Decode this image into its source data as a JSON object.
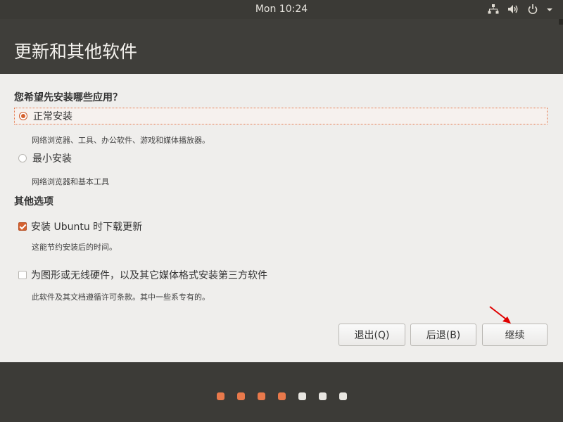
{
  "topbar": {
    "clock": "Mon 10:24"
  },
  "header": {
    "title": "更新和其他软件"
  },
  "main": {
    "question": "您希望先安装哪些应用？",
    "normal_install": {
      "label": "正常安装",
      "desc": "网络浏览器、工具、办公软件、游戏和媒体播放器。",
      "selected": true
    },
    "minimal_install": {
      "label": "最小安装",
      "desc": "网络浏览器和基本工具",
      "selected": false
    },
    "other_options": "其他选项",
    "download_updates": {
      "label": "安装 Ubuntu 时下载更新",
      "desc": "这能节约安装后的时间。",
      "checked": true
    },
    "third_party": {
      "label": "为图形或无线硬件，以及其它媒体格式安装第三方软件",
      "desc": "此软件及其文档遵循许可条款。其中一些系专有的。",
      "checked": false
    }
  },
  "buttons": {
    "quit": "退出(Q)",
    "back": "后退(B)",
    "continue": "继续"
  },
  "progress": {
    "total": 7,
    "completed": 4
  },
  "colors": {
    "accent": "#e95420",
    "dot_done": "#e9794b",
    "dot_todo": "#e8e6e1",
    "arrow": "#e00000"
  }
}
